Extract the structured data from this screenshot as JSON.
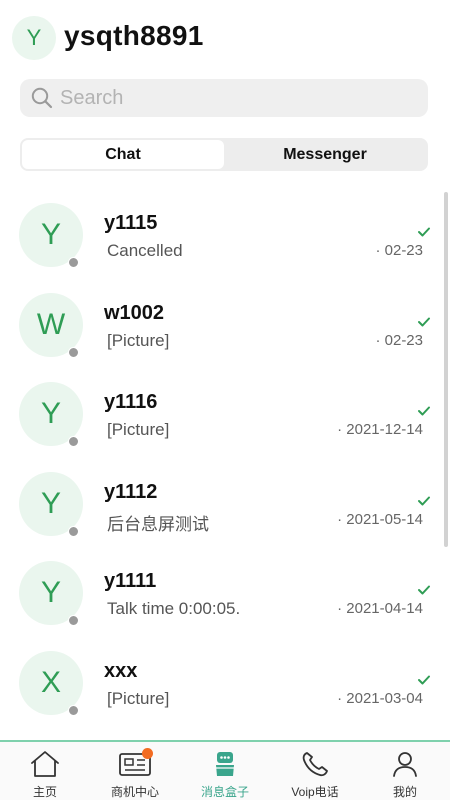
{
  "header": {
    "avatar_letter": "Y",
    "username": "ysqth8891"
  },
  "search": {
    "placeholder": "Search"
  },
  "segments": [
    {
      "label": "Chat",
      "active": true
    },
    {
      "label": "Messenger",
      "active": false
    }
  ],
  "conversations": [
    {
      "avatar_letter": "Y",
      "name": "y1115",
      "preview": "Cancelled",
      "date": "· 02-23"
    },
    {
      "avatar_letter": "W",
      "name": "w1002",
      "preview": "[Picture]",
      "date": "· 02-23"
    },
    {
      "avatar_letter": "Y",
      "name": "y1116",
      "preview": "[Picture]",
      "date": "· 2021-12-14"
    },
    {
      "avatar_letter": "Y",
      "name": "y1112",
      "preview": "后台息屏测试",
      "date": "· 2021-05-14"
    },
    {
      "avatar_letter": "Y",
      "name": "y1111",
      "preview": "Talk time 0:00:05.",
      "date": "· 2021-04-14"
    },
    {
      "avatar_letter": "X",
      "name": "xxx",
      "preview": "[Picture]",
      "date": "· 2021-03-04"
    }
  ],
  "tabbar": [
    {
      "label": "主页",
      "icon": "home-icon"
    },
    {
      "label": "商机中心",
      "icon": "business-card-icon"
    },
    {
      "label": "消息盒子",
      "icon": "message-box-icon"
    },
    {
      "label": "Voip电话",
      "icon": "phone-icon"
    },
    {
      "label": "我的",
      "icon": "profile-icon"
    }
  ],
  "colors": {
    "accent": "#2f9d55",
    "avatar_bg": "#eaf6ee",
    "active_tab": "#3aa58c",
    "badge": "#f26b21",
    "offline_dot": "#9a9a9a"
  }
}
